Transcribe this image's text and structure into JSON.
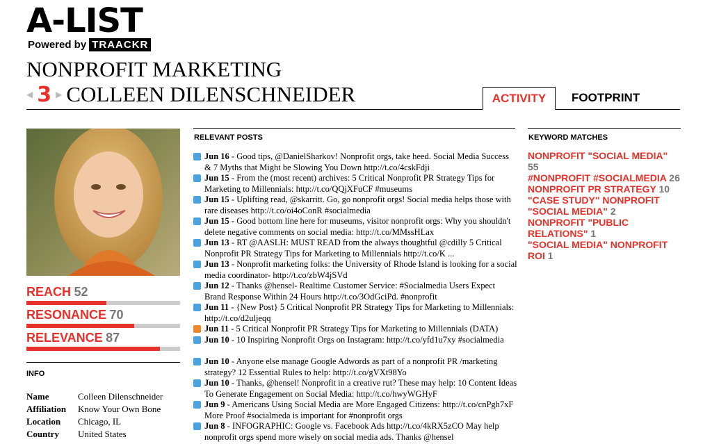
{
  "brand": {
    "title": "A-LIST",
    "powered_by": "Powered by",
    "traackr": "TRAACKR"
  },
  "list_title": "NONPROFIT MARKETING",
  "rank": "3",
  "person_name": "COLLEEN DILENSCHNEIDER",
  "tabs": {
    "activity": "ACTIVITY",
    "footprint": "FOOTPRINT"
  },
  "metrics": [
    {
      "label": "REACH",
      "value": "52",
      "fill": 0.52
    },
    {
      "label": "RESONANCE",
      "value": "70",
      "fill": 0.7
    },
    {
      "label": "RELEVANCE",
      "value": "87",
      "fill": 0.87
    }
  ],
  "info": {
    "heading": "INFO",
    "rows": [
      {
        "key": "Name",
        "value": "Colleen Dilenschneider"
      },
      {
        "key": "Affiliation",
        "value": "Know Your Own Bone"
      },
      {
        "key": "Location",
        "value": "Chicago, IL"
      },
      {
        "key": "Country",
        "value": "United States"
      }
    ]
  },
  "posts": {
    "heading": "RELEVANT POSTS",
    "items": [
      {
        "icon": "twitter-icon",
        "date": "Jun 16",
        "text": "- Good tips, @DanielSharkov! Nonprofit orgs, take heed. Social Media Success & 7 Myths that Might be Slowing You Down http://t.co/4cskFdji"
      },
      {
        "icon": "twitter-icon",
        "date": "Jun 15",
        "text": "- From the (most recent) archives: 5 Critical Nonprofit PR Strategy Tips for Marketing to Millennials: http://t.co/QQjXFuCF #museums"
      },
      {
        "icon": "twitter-icon",
        "date": "Jun 15",
        "text": "- Uplifting read, @skarritt. Go, go nonprofit orgs! Social media helps those with rare diseases http://t.co/oi4oConR #socialmedia"
      },
      {
        "icon": "twitter-icon",
        "date": "Jun 15",
        "text": "- Good bottom line here for museums, visitor nonprofit orgs: Why you shouldn't delete negative comments on social media: http://t.co/MMssHLax"
      },
      {
        "icon": "twitter-icon",
        "date": "Jun 13",
        "text": "- RT @AASLH: MUST READ from the always thoughtful @cdilly 5 Critical Nonprofit PR Strategy Tips for Marketing to Millennials http://t.co/K ..."
      },
      {
        "icon": "twitter-icon",
        "date": "Jun 13",
        "text": "- Nonprofit marketing folks: the University of Rhode Island is looking for a social media coordinator- http://t.co/zbW4jSVd"
      },
      {
        "icon": "twitter-icon",
        "date": "Jun 12",
        "text": "- Thanks @hensel- Realtime Customer Service: #Socialmedia Users Expect Brand Response Within 24 Hours http://t.co/3OdGciPd. #nonprofit"
      },
      {
        "icon": "twitter-icon",
        "date": "Jun 11",
        "text": "- {New Post} 5 Critical Nonprofit PR Strategy Tips for Marketing to Millennials: http://t.co/d2uljeqq"
      },
      {
        "icon": "rss-icon",
        "date": "Jun 11",
        "text": "- 5 Critical Nonprofit PR Strategy Tips for Marketing to Millennials (DATA)",
        "single": true
      },
      {
        "icon": "twitter-icon",
        "date": "Jun 10",
        "text": "- 10 Inspiring Nonprofit Orgs on Instagram: http://t.co/yfd1u7xy #socialmedia"
      },
      {
        "icon": "twitter-icon",
        "date": "Jun 10",
        "text": "- Anyone else manage Google Adwords as part of a nonprofit PR /marketing strategy? 12 Essential Rules to help: http://t.co/gVXt98Yo"
      },
      {
        "icon": "twitter-icon",
        "date": "Jun 10",
        "text": "- Thanks, @hensel! Nonprofit in a creative rut? These may help: 10 Content Ideas To Generate Engagement on Social Media: http://t.co/hwyWGHyF"
      },
      {
        "icon": "twitter-icon",
        "date": "Jun 9",
        "text": "- Americans Using Social Media are More Engaged Citizens: http://t.co/cnPgh7xF More Proof #socialmeda is important for #nonprofit orgs"
      },
      {
        "icon": "twitter-icon",
        "date": "Jun 8",
        "text": "- INFOGRAPHIC: Google vs. Facebook Ads http://t.co/4kRX5zCO May help nonprofit orgs spend more wisely on social media ads. Thanks @hensel"
      }
    ]
  },
  "keywords": {
    "heading": "KEYWORD MATCHES",
    "items": [
      {
        "term": "NONPROFIT \"SOCIAL MEDIA\"",
        "count": "55"
      },
      {
        "term": "#NONPROFIT #SOCIALMEDIA",
        "count": "26"
      },
      {
        "term": "NONPROFIT PR STRATEGY",
        "count": "10"
      },
      {
        "term": "\"CASE STUDY\" NONPROFIT \"SOCIAL MEDIA\"",
        "count": "2"
      },
      {
        "term": "NONPROFIT \"PUBLIC RELATIONS\"",
        "count": "1"
      },
      {
        "term": "\"SOCIAL MEDIA\" NONPROFIT ROI",
        "count": "1"
      }
    ]
  },
  "colors": {
    "accent": "#e8312a",
    "muted": "#777777",
    "bar_bg": "#cccccc"
  }
}
